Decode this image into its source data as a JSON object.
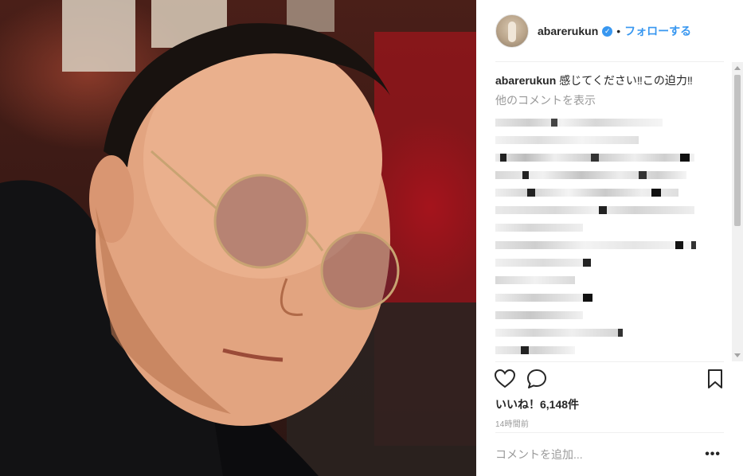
{
  "post": {
    "username": "abarerukun",
    "verified_icon": "verified-badge-icon",
    "separator": "•",
    "follow_label": "フォローする",
    "caption_user": "abarerukun",
    "caption_text": "感じてください‼この迫力‼",
    "view_more_comments": "他のコメントを表示",
    "likes_text": "いいね！6,148件",
    "timestamp": "14時間前",
    "comment_placeholder": "コメントを追加...",
    "more_options": "•••"
  },
  "icons": {
    "like": "heart-icon",
    "comment": "comment-icon",
    "save": "bookmark-icon",
    "avatar": "avatar"
  },
  "colors": {
    "accent": "#3897f0",
    "text": "#262626",
    "muted": "#999999",
    "divider": "#efefef"
  }
}
